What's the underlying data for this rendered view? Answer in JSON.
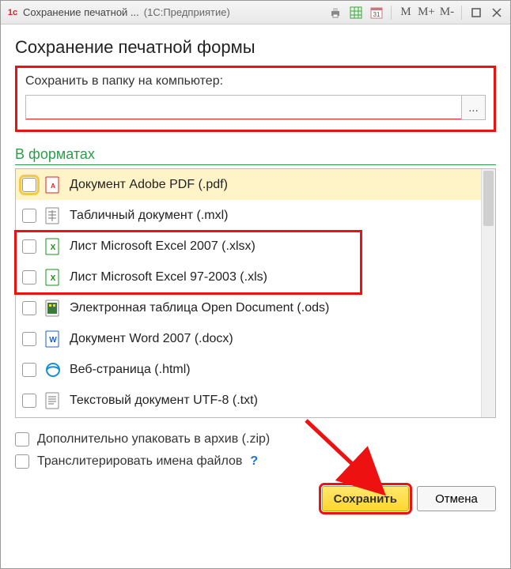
{
  "titlebar": {
    "title": "Сохранение печатной ...",
    "subtitle": "(1С:Предприятие)",
    "letters": [
      "M",
      "M+",
      "M-"
    ]
  },
  "heading": "Сохранение печатной формы",
  "folder": {
    "label": "Сохранить в папку на компьютер:",
    "path_value": "",
    "browse": "..."
  },
  "formats_heading": "В форматах",
  "formats": [
    {
      "label": "Документ Adobe PDF (.pdf)",
      "icon": "pdf",
      "selected": true
    },
    {
      "label": "Табличный документ (.mxl)",
      "icon": "mxl"
    },
    {
      "label": "Лист Microsoft Excel 2007 (.xlsx)",
      "icon": "xls"
    },
    {
      "label": "Лист Microsoft Excel 97-2003 (.xls)",
      "icon": "xls"
    },
    {
      "label": "Электронная таблица Open Document (.ods)",
      "icon": "ods"
    },
    {
      "label": "Документ Word 2007 (.docx)",
      "icon": "doc"
    },
    {
      "label": "Веб-страница (.html)",
      "icon": "html"
    },
    {
      "label": "Текстовый документ UTF-8 (.txt)",
      "icon": "txt"
    }
  ],
  "options": {
    "zip_label": "Дополнительно упаковать в архив (.zip)",
    "translit_label": "Транслитерировать имена файлов"
  },
  "buttons": {
    "save": "Сохранить",
    "cancel": "Отмена"
  },
  "colors": {
    "highlight_red": "#e11",
    "accent_green": "#2a9d4a",
    "primary_yellow": "#ffd633"
  }
}
